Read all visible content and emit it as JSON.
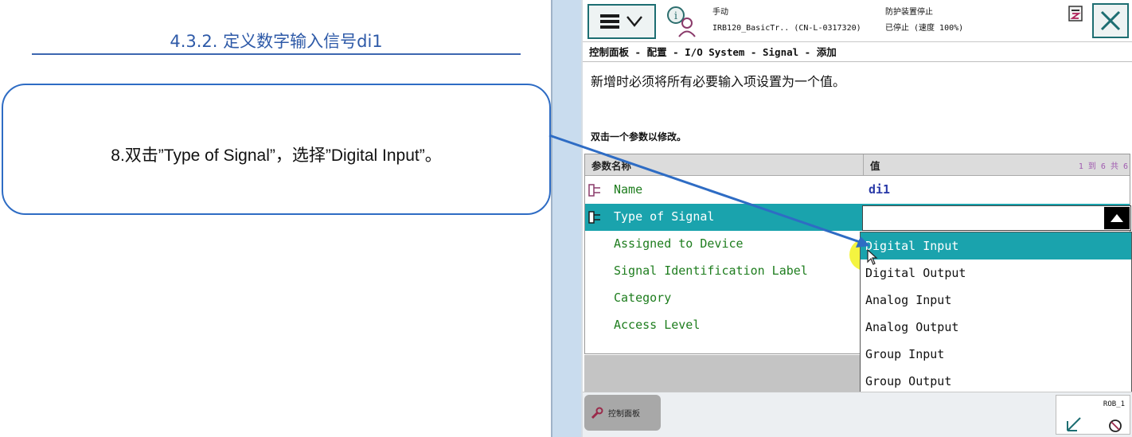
{
  "slide": {
    "title": "4.3.2. 定义数字输入信号di1",
    "step_text": "8.双击”Type of Signal”，选择”Digital Input”。"
  },
  "pendant": {
    "status": {
      "mode": "手动",
      "system": "IRB120_BasicTr.. (CN-L-0317320)",
      "protection": "防护装置停止",
      "state": "已停止 (速度 100%)"
    },
    "breadcrumb": "控制面板 - 配置 - I/O System - Signal - 添加",
    "instruction": "新增时必须将所有必要输入项设置为一个值。",
    "hint": "双击一个参数以修改。",
    "table": {
      "col_param": "参数名称",
      "col_value": "值",
      "page_info": "1 到 6 共 6",
      "rows": [
        {
          "name": "Name",
          "value": "di1"
        },
        {
          "name": "Type of Signal",
          "value": ""
        },
        {
          "name": "Assigned to Device",
          "value": ""
        },
        {
          "name": "Signal Identification Label",
          "value": ""
        },
        {
          "name": "Category",
          "value": ""
        },
        {
          "name": "Access Level",
          "value": ""
        }
      ]
    },
    "dropdown_options": [
      "Digital Input",
      "Digital Output",
      "Analog Input",
      "Analog Output",
      "Group Input",
      "Group Output"
    ],
    "selected_option": "Digital Input",
    "taskbar_label": "控制面板",
    "robot_label": "ROB_1",
    "colors": {
      "accent": "#1aa3ad",
      "param_text": "#1e7d1e",
      "value_text": "#2a3aa8",
      "annotation_arrow": "#2e6cc4"
    }
  }
}
